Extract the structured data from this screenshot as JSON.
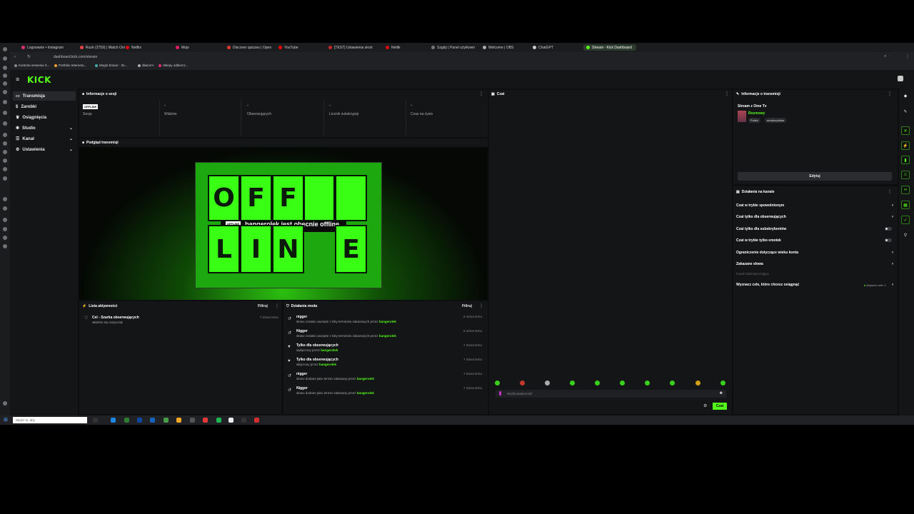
{
  "browser": {
    "tabs": [
      {
        "label": "Logowanie • Instagram",
        "color": "#e1306c"
      },
      {
        "label": "Rush (2759) | Watch Onl",
        "color": "#e44"
      },
      {
        "label": "Netflix",
        "color": "#e50914"
      },
      {
        "label": "Mojo",
        "color": "#e91e63"
      },
      {
        "label": "Discover quizzes | Open",
        "color": "#e53935"
      },
      {
        "label": "YouTube",
        "color": "#ff0000"
      },
      {
        "label": "[TEST] Ustawienia skrot",
        "color": "#c62828"
      },
      {
        "label": "Netlik",
        "color": "#e50914"
      },
      {
        "label": "Szgdy | Panel użytkown",
        "color": "#777"
      },
      {
        "label": "Welcome | OBS",
        "color": "#aaa"
      },
      {
        "label": "ChatGPT",
        "color": "#ccc"
      },
      {
        "label": "Stream - Kick Dashboard",
        "color": "#53fc18"
      }
    ],
    "address": "dashboard.kick.com/stream",
    "bookmarks": [
      {
        "label": "Kontrola sesseów X...",
        "color": "#888"
      },
      {
        "label": "Portfolio Internetu...",
        "color": "#f0a030"
      },
      {
        "label": "Moglo Erasor - Its...",
        "color": "#4aa"
      },
      {
        "label": "dlaevrrA",
        "color": "#aaa"
      },
      {
        "label": "Sklepy odbiercz...",
        "color": "#e1306c"
      }
    ]
  },
  "sidebar": {
    "items": [
      {
        "label": "Transmisja",
        "active": true
      },
      {
        "label": "Zarobki",
        "active": false
      },
      {
        "label": "Osiągnięcia",
        "active": false
      },
      {
        "label": "Studio",
        "active": false,
        "chevron": true
      },
      {
        "label": "Kanał",
        "active": false,
        "chevron": true
      },
      {
        "label": "Ustawienia",
        "active": false,
        "chevron": true
      }
    ]
  },
  "session": {
    "title": "Informacje o sesji",
    "badge": "OFFLINE",
    "stats": [
      {
        "value": "",
        "label": "Sesja"
      },
      {
        "value": "-",
        "label": "Widzów"
      },
      {
        "value": "-",
        "label": "Obserwujących"
      },
      {
        "value": "-",
        "label": "Licznik subskrypcji"
      },
      {
        "value": "-",
        "label": "Czas na żywo"
      }
    ]
  },
  "preview": {
    "title": "Podgląd transmisji",
    "letters": [
      "O",
      "F",
      "F",
      "",
      "",
      "L",
      "I",
      "N",
      "E"
    ],
    "pill": "OFFLINE",
    "message": "bangerolek jest obecnie offline"
  },
  "activity": {
    "title": "Lista aktywności",
    "filter": "Filtruj",
    "items": [
      {
        "title": "Cel - Szarka obserwujących",
        "sub": "właśnie się rozpoczął",
        "time": "7 minut temu"
      }
    ]
  },
  "mod": {
    "title": "Działania moda",
    "filter": "Filtruj",
    "items": [
      {
        "title": "nigger",
        "sub": "słowo zostało usunięte z listy terminów zakazanych przez",
        "user": "bangerolek",
        "time": "6 minut temu",
        "icon": "↺"
      },
      {
        "title": "Nigger",
        "sub": "słowo zostało usunięte z listy terminów zakazanych przez",
        "user": "bangerolek",
        "time": "6 minut temu",
        "icon": "↺"
      },
      {
        "title": "Tylko dla obserwujących",
        "sub": "wyłączony przez",
        "user": "bangerolek",
        "time": "7 minut temu",
        "icon": "♥"
      },
      {
        "title": "Tylko dla obserwujących",
        "sub": "włączony przez",
        "user": "bangerolek",
        "time": "7 minut temu",
        "icon": "♥"
      },
      {
        "title": "nigger",
        "sub": "słowo dodane jako termin zakazany przez",
        "user": "bangerolek",
        "time": "7 minut temu",
        "icon": "↺"
      },
      {
        "title": "Nigger",
        "sub": "słowo dodane jako termin zakazany przez",
        "user": "bangerolek",
        "time": "7 minut temu",
        "icon": "↺"
      }
    ]
  },
  "chat": {
    "title": "Czat",
    "placeholder": "Wyślij wiadomość",
    "send": "Czat"
  },
  "stream_info": {
    "title": "Informacje o transmisji",
    "stream_title": "Stream z Ome Tv",
    "category": "Rozmowy",
    "tags": [
      "Polish",
      "amatorpolska"
    ],
    "edit": "Edytuj"
  },
  "channel": {
    "title": "Działania na kanale",
    "actions": [
      {
        "label": "Czat w trybie spowolnionym",
        "kind": "chevron"
      },
      {
        "label": "Czat tylko dla obserwujących",
        "kind": "chevron"
      },
      {
        "label": "Czat tylko dla subskrybentów",
        "kind": "toggle"
      },
      {
        "label": "Czat w trybie tylko emotek",
        "kind": "toggle"
      },
      {
        "label": "Ograniczenie dotyczące wieku konta",
        "kind": "chevron"
      },
      {
        "label": "Zakazane słowa",
        "kind": "chevron"
      }
    ],
    "footer_note": "Kanał zabezpieczający",
    "goal": "Wyznacz cele, które chcesz osiągnąć",
    "goal_status": "Aktywne cele: 1"
  },
  "taskbar": {
    "search": "Wpisz tu, aby"
  },
  "colors": {
    "accent": "#53fc18",
    "panel": "#141517",
    "bg": "#0d0e0f"
  }
}
